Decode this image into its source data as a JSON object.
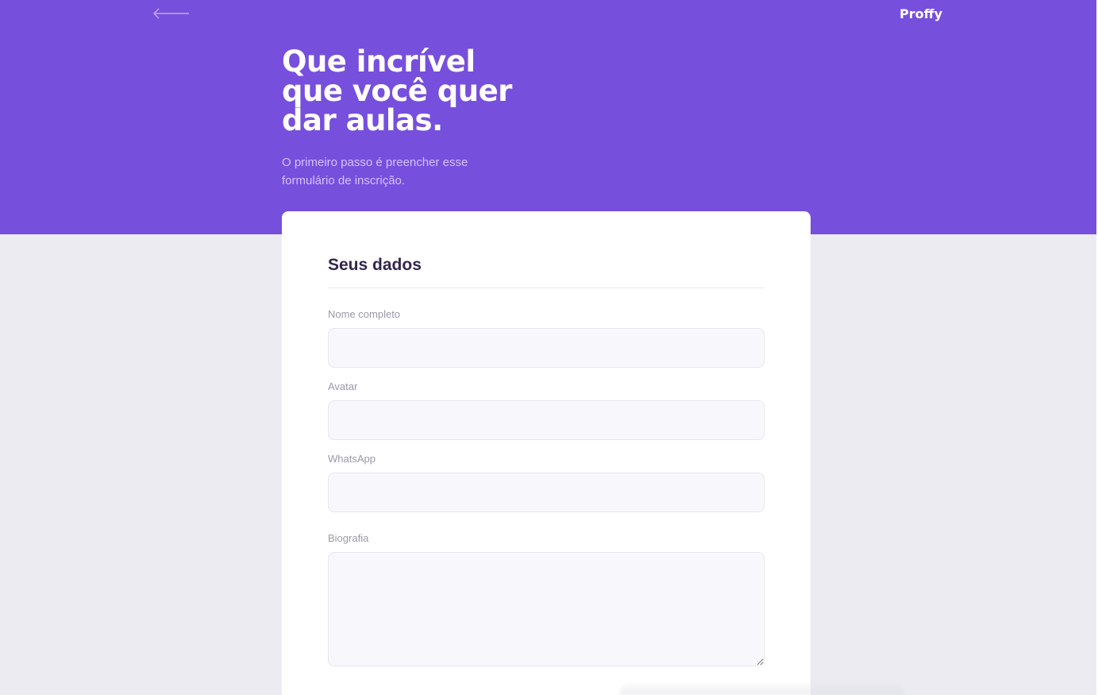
{
  "header": {
    "back_icon": "arrow-left-icon",
    "logo": "Proffy"
  },
  "hero": {
    "title_lines": [
      "Que incrível",
      "que você quer",
      "dar aulas."
    ],
    "subtitle_lines": [
      "O primeiro passo é preencher esse",
      "formulário de inscrição."
    ]
  },
  "form": {
    "section_title": "Seus dados",
    "fields": [
      {
        "label": "Nome completo",
        "value": ""
      },
      {
        "label": "Avatar",
        "value": ""
      },
      {
        "label": "WhatsApp",
        "value": ""
      },
      {
        "label": "Biografia",
        "value": ""
      }
    ]
  },
  "colors": {
    "primary": "#774FDD",
    "background": "#EBEBF1",
    "title": "#32264D",
    "label": "#9C98A6",
    "input_bg": "#F8F8FC",
    "input_border": "#E6E6F0"
  }
}
